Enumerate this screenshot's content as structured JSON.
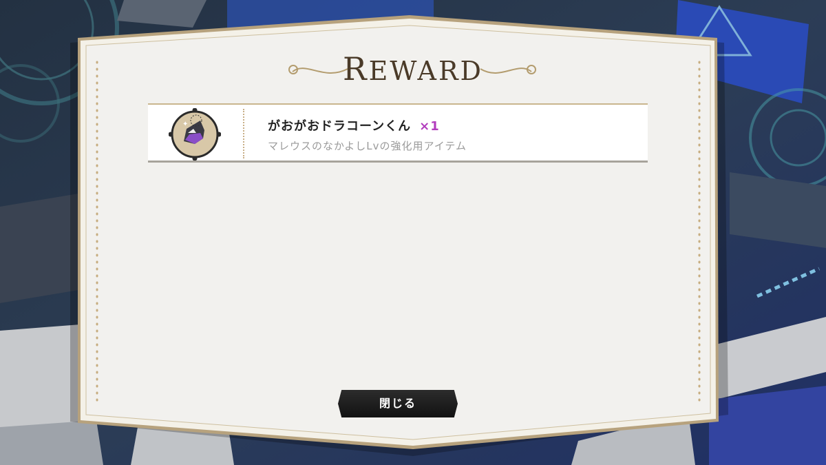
{
  "dialog": {
    "title_first": "R",
    "title_rest": "EWARD",
    "close_label": "閉じる"
  },
  "rewards": [
    {
      "name": "がおがおドラコーンくん",
      "quantity": "×1",
      "description": "マレウスのなかよしLvの強化用アイテム",
      "icon": "dragon-plush-icon"
    }
  ],
  "colors": {
    "panel": "#f2f1ee",
    "frame": "#b7a27d",
    "quantity": "#b23dbd",
    "title": "#4a3a28"
  }
}
